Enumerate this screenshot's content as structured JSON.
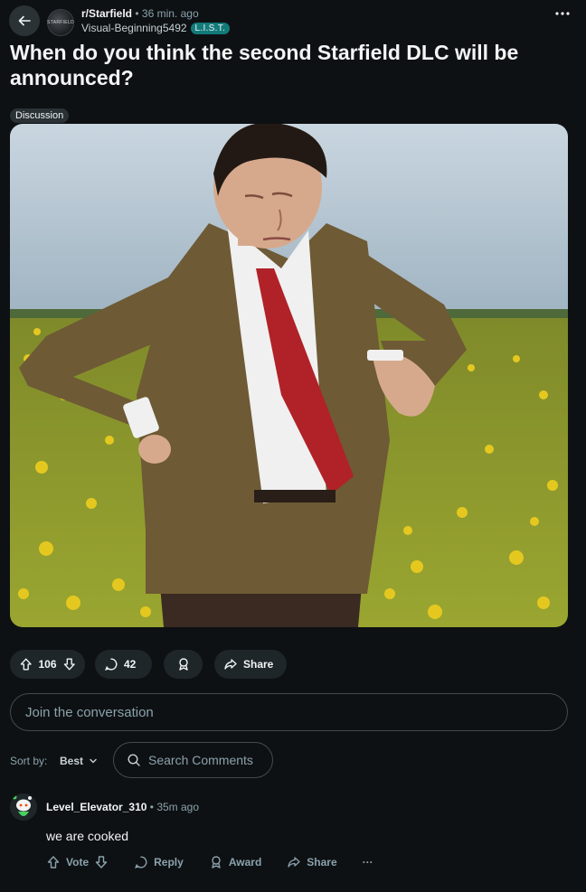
{
  "header": {
    "subreddit": "r/Starfield",
    "dot": "•",
    "time_ago": "36 min. ago",
    "username": "Visual-Beginning5492",
    "user_flair": "L.I.S.T."
  },
  "post": {
    "title": "When do you think the second Starfield DLC will be announced?",
    "flair": "Discussion"
  },
  "actions": {
    "upvotes": "106",
    "comments": "42",
    "share_label": "Share"
  },
  "comment_box": {
    "placeholder": "Join the conversation"
  },
  "sort": {
    "label": "Sort by:",
    "value": "Best"
  },
  "comment_search": {
    "placeholder": "Search Comments"
  },
  "comment": {
    "author": "Level_Elevator_310",
    "dot": "•",
    "time_ago": "35m ago",
    "body": "we are cooked",
    "vote_label": "Vote",
    "reply_label": "Reply",
    "award_label": "Award",
    "share_label": "Share",
    "more": "···"
  },
  "colors": {
    "background": "#0e1113",
    "pill": "#1f2629",
    "flair_teal": "#127b7a",
    "muted_text": "#8ba2ad"
  },
  "icons": [
    "back-arrow-icon",
    "more-horizontal-icon",
    "upvote-icon",
    "downvote-icon",
    "comment-icon",
    "award-icon",
    "share-icon",
    "search-icon",
    "chevron-down-icon"
  ]
}
